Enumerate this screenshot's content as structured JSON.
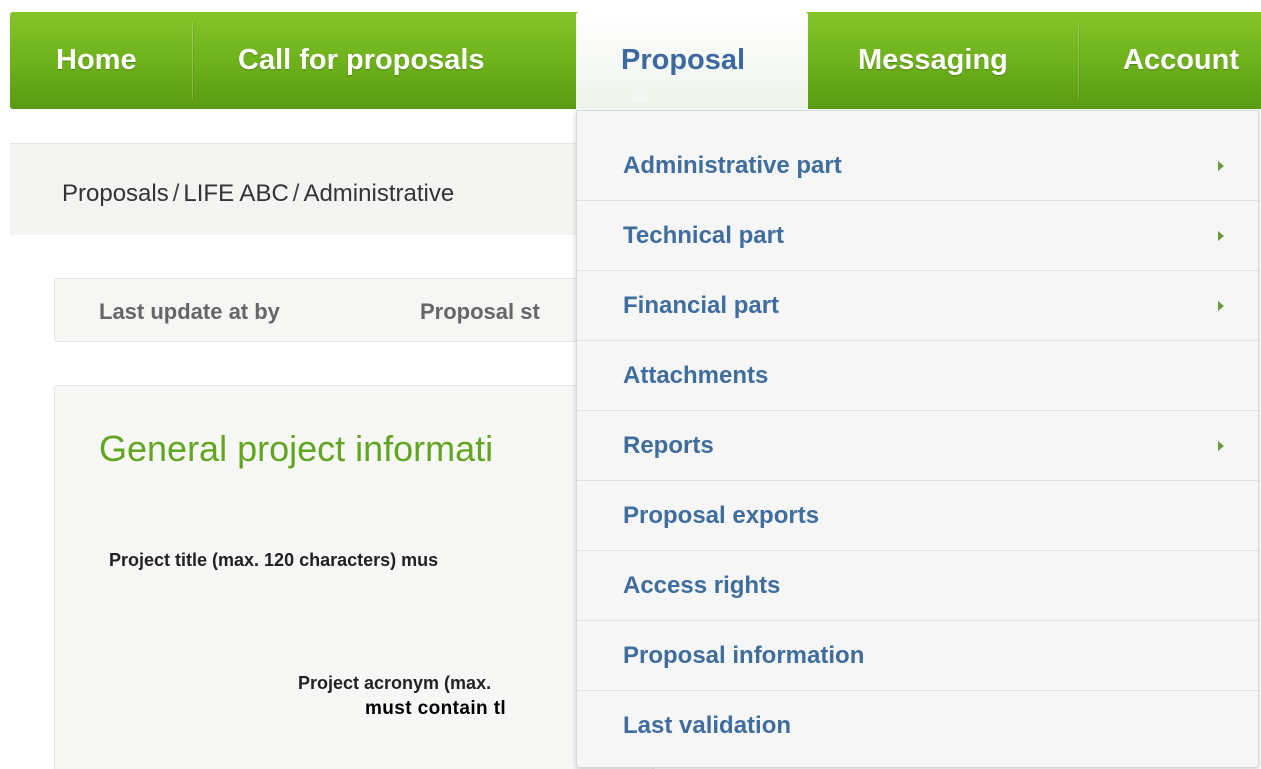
{
  "nav": {
    "items": [
      {
        "label": "Home"
      },
      {
        "label": "Call for proposals"
      },
      {
        "label": "Proposal"
      },
      {
        "label": "Messaging"
      },
      {
        "label": "Account"
      }
    ],
    "active": "Proposal"
  },
  "breadcrumb": {
    "items": [
      "Proposals",
      "LIFE ABC",
      "Administrative"
    ],
    "separator": "/"
  },
  "status": {
    "last_update": "Last update at by",
    "proposal_state": "Proposal st"
  },
  "section": {
    "title": "General project informati",
    "project_title_label": "Project title (max. 120 characters) mus",
    "project_acronym_label": "Project acronym (max.",
    "must_contain": "must contain tl"
  },
  "dropdown": {
    "items": [
      {
        "label": "Administrative part",
        "has_submenu": true
      },
      {
        "label": "Technical part",
        "has_submenu": true
      },
      {
        "label": "Financial part",
        "has_submenu": true
      },
      {
        "label": "Attachments",
        "has_submenu": false
      },
      {
        "label": "Reports",
        "has_submenu": true
      },
      {
        "label": "Proposal exports",
        "has_submenu": false
      },
      {
        "label": "Access rights",
        "has_submenu": false
      },
      {
        "label": "Proposal information",
        "has_submenu": false
      },
      {
        "label": "Last validation",
        "has_submenu": false
      }
    ]
  },
  "colors": {
    "nav_green": "#6cb01b",
    "link_blue": "#3f6d9e",
    "title_green": "#62a520"
  }
}
